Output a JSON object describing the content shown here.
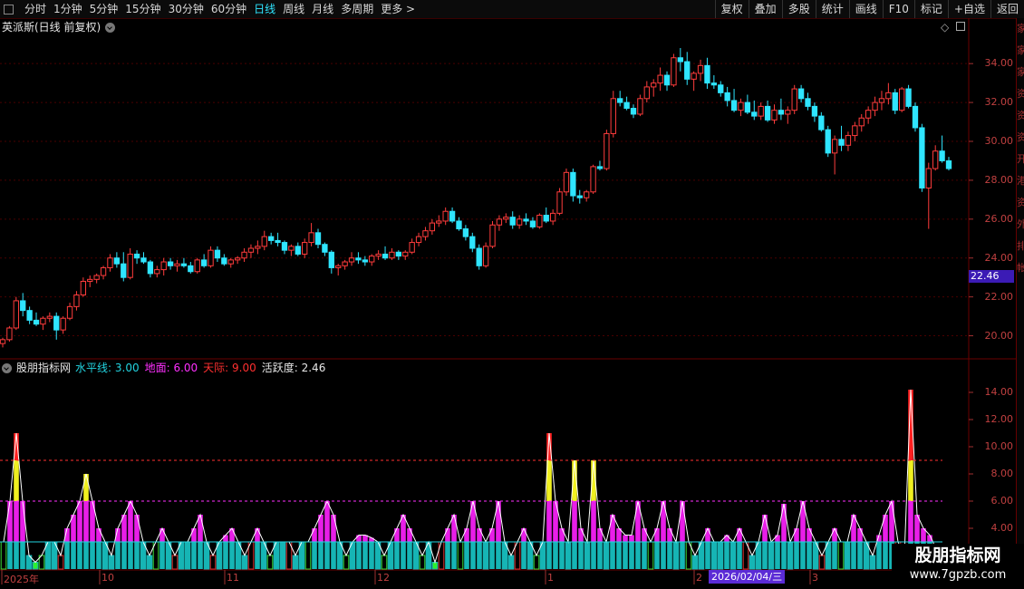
{
  "toolbar": {
    "periods": [
      "分时",
      "1分钟",
      "5分钟",
      "15分钟",
      "30分钟",
      "60分钟",
      "日线",
      "周线",
      "月线",
      "多周期",
      "更多 >"
    ],
    "active_period": "日线",
    "right_buttons": [
      "复权",
      "叠加",
      "多股",
      "统计",
      "画线",
      "F10",
      "标记",
      "+自选",
      "返回"
    ]
  },
  "main_panel": {
    "title": "英派斯(日线 前复权)",
    "y_ticks": [
      "34.00",
      "32.00",
      "30.00",
      "28.00",
      "26.00",
      "24.00",
      "22.00",
      "20.00"
    ],
    "current_price_tag": "22.46"
  },
  "indicator_panel": {
    "name": "股朋指标网",
    "legend": [
      {
        "label": "水平线: 3.00",
        "color": "#22d3e0"
      },
      {
        "label": "地面: 6.00",
        "color": "#ff30ff"
      },
      {
        "label": "天际: 9.00",
        "color": "#ff3030"
      },
      {
        "label": "活跃度: 2.46",
        "color": "#e6e6e6"
      }
    ],
    "y_ticks": [
      "14.00",
      "12.00",
      "10.00",
      "8.00",
      "6.00",
      "4.00",
      "2.00"
    ]
  },
  "x_axis": {
    "months": [
      "2025年",
      "10",
      "11",
      "12",
      "1",
      "2",
      "3"
    ],
    "cursor_date": "2026/02/04/三"
  },
  "watermark": {
    "title": "股朋指标网",
    "url": "www.7gpzb.com"
  },
  "side_strip_text": [
    "家",
    "家",
    "家",
    "资",
    "资",
    "资",
    "开",
    "港",
    "资",
    "外",
    "排",
    "帐"
  ],
  "colors": {
    "up": "#ff3c3c",
    "down": "#2fe5ff",
    "bg": "#000000",
    "grid": "#5a0000"
  },
  "chart_data": {
    "type": "candlestick+histogram",
    "price_axis_ylim": [
      19,
      35.5
    ],
    "candles_ohlc": [
      [
        19.6,
        19.9,
        19.4,
        19.8
      ],
      [
        19.8,
        20.5,
        19.7,
        20.4
      ],
      [
        20.4,
        22,
        20.3,
        21.8
      ],
      [
        21.8,
        22.2,
        21,
        21.3
      ],
      [
        21.3,
        21.5,
        20.6,
        20.8
      ],
      [
        20.8,
        21.2,
        20.5,
        20.6
      ],
      [
        20.6,
        21,
        20.3,
        20.9
      ],
      [
        20.9,
        21.2,
        20.7,
        21
      ],
      [
        21,
        21.2,
        19.8,
        20.3
      ],
      [
        20.3,
        21,
        20.1,
        20.9
      ],
      [
        20.9,
        21.7,
        20.8,
        21.5
      ],
      [
        21.5,
        22.3,
        21.3,
        22.1
      ],
      [
        22.1,
        23,
        22,
        22.8
      ],
      [
        22.8,
        23.1,
        22.5,
        22.9
      ],
      [
        22.9,
        23.2,
        22.7,
        23.1
      ],
      [
        23.1,
        23.6,
        22.9,
        23.5
      ],
      [
        23.5,
        24.2,
        23.3,
        24
      ],
      [
        24,
        24.3,
        23.5,
        23.7
      ],
      [
        23.7,
        24.3,
        22.8,
        23
      ],
      [
        23,
        24.5,
        22.9,
        24.2
      ],
      [
        24.2,
        24.4,
        23.7,
        24
      ],
      [
        24,
        24.3,
        23.7,
        23.8
      ],
      [
        23.8,
        23.9,
        23,
        23.2
      ],
      [
        23.2,
        23.6,
        23,
        23.4
      ],
      [
        23.4,
        24,
        23.1,
        23.8
      ],
      [
        23.8,
        24,
        23.4,
        23.6
      ],
      [
        23.6,
        23.9,
        23.3,
        23.7
      ],
      [
        23.7,
        24,
        23.5,
        23.6
      ],
      [
        23.6,
        23.8,
        23.2,
        23.3
      ],
      [
        23.3,
        24,
        23.2,
        23.9
      ],
      [
        23.9,
        24.2,
        23.5,
        23.6
      ],
      [
        23.6,
        24.6,
        23.5,
        24.4
      ],
      [
        24.4,
        24.6,
        23.8,
        24
      ],
      [
        24,
        24.2,
        23.6,
        23.7
      ],
      [
        23.7,
        24,
        23.5,
        23.9
      ],
      [
        23.9,
        24.1,
        23.7,
        24
      ],
      [
        24,
        24.5,
        23.8,
        24.3
      ],
      [
        24.3,
        24.7,
        24,
        24.5
      ],
      [
        24.5,
        24.9,
        24.2,
        24.6
      ],
      [
        24.6,
        25.4,
        24.4,
        25.1
      ],
      [
        25.1,
        25.3,
        24.7,
        24.9
      ],
      [
        24.9,
        25.3,
        24.6,
        24.8
      ],
      [
        24.8,
        24.9,
        24.2,
        24.4
      ],
      [
        24.4,
        24.7,
        24.1,
        24.6
      ],
      [
        24.6,
        24.8,
        24.1,
        24.2
      ],
      [
        24.2,
        25,
        24,
        24.8
      ],
      [
        24.8,
        25.8,
        24.6,
        25.3
      ],
      [
        25.3,
        25.5,
        24.5,
        24.7
      ],
      [
        24.7,
        24.8,
        24.1,
        24.3
      ],
      [
        24.3,
        24.4,
        23.2,
        23.5
      ],
      [
        23.5,
        23.7,
        23.1,
        23.6
      ],
      [
        23.6,
        23.9,
        23.4,
        23.8
      ],
      [
        23.8,
        24.3,
        23.6,
        24
      ],
      [
        24,
        24.3,
        23.7,
        23.9
      ],
      [
        23.9,
        24.1,
        23.6,
        23.8
      ],
      [
        23.8,
        24.2,
        23.6,
        24.1
      ],
      [
        24.1,
        24.4,
        23.9,
        24.2
      ],
      [
        24.2,
        24.6,
        23.9,
        24
      ],
      [
        24,
        24.5,
        23.9,
        24.3
      ],
      [
        24.3,
        24.4,
        23.9,
        24.1
      ],
      [
        24.1,
        24.4,
        23.9,
        24.3
      ],
      [
        24.3,
        25,
        24.2,
        24.8
      ],
      [
        24.8,
        25.3,
        24.6,
        25.1
      ],
      [
        25.1,
        25.6,
        24.9,
        25.4
      ],
      [
        25.4,
        26,
        25.2,
        25.8
      ],
      [
        25.8,
        26.2,
        25.6,
        25.9
      ],
      [
        25.9,
        26.6,
        25.7,
        26.4
      ],
      [
        26.4,
        26.6,
        25.8,
        25.9
      ],
      [
        25.9,
        26.1,
        25.4,
        25.5
      ],
      [
        25.5,
        25.7,
        24.9,
        25.1
      ],
      [
        25.1,
        25.3,
        24.3,
        24.5
      ],
      [
        24.5,
        24.7,
        23.4,
        23.6
      ],
      [
        23.6,
        24.8,
        23.5,
        24.6
      ],
      [
        24.6,
        25.9,
        24.5,
        25.7
      ],
      [
        25.7,
        26.2,
        25.4,
        26
      ],
      [
        26,
        26.3,
        25.8,
        26.1
      ],
      [
        26.1,
        26.4,
        25.5,
        25.7
      ],
      [
        25.7,
        26.2,
        25.5,
        26
      ],
      [
        26,
        26.3,
        25.7,
        25.9
      ],
      [
        25.9,
        26.1,
        25.5,
        25.6
      ],
      [
        25.6,
        26.3,
        25.5,
        26.2
      ],
      [
        26.2,
        26.6,
        25.8,
        25.9
      ],
      [
        25.9,
        26.5,
        25.7,
        26.3
      ],
      [
        26.3,
        27.6,
        26.2,
        27.4
      ],
      [
        27.4,
        28.6,
        27.2,
        28.4
      ],
      [
        28.4,
        28.6,
        26.9,
        27.2
      ],
      [
        27.2,
        27.5,
        26.8,
        27.1
      ],
      [
        27.1,
        27.5,
        26.9,
        27.4
      ],
      [
        27.4,
        28.8,
        27.3,
        28.7
      ],
      [
        28.7,
        29,
        28.5,
        28.6
      ],
      [
        28.6,
        30.6,
        28.5,
        30.4
      ],
      [
        30.4,
        32.6,
        30.2,
        32.2
      ],
      [
        32.2,
        32.6,
        31.8,
        32
      ],
      [
        32,
        32.3,
        31.6,
        31.7
      ],
      [
        31.7,
        31.9,
        31.2,
        31.4
      ],
      [
        31.4,
        32.4,
        31.3,
        32.2
      ],
      [
        32.2,
        33.1,
        32,
        32.8
      ],
      [
        32.8,
        33.2,
        32.3,
        33
      ],
      [
        33,
        33.8,
        32.6,
        33.4
      ],
      [
        33.4,
        33.6,
        32.6,
        32.9
      ],
      [
        32.9,
        34.5,
        32.8,
        34.3
      ],
      [
        34.3,
        34.8,
        33.6,
        34.1
      ],
      [
        34.1,
        34.6,
        32.9,
        33.2
      ],
      [
        33.2,
        33.6,
        32.6,
        33.5
      ],
      [
        33.5,
        34.2,
        33.1,
        33.9
      ],
      [
        33.9,
        34.3,
        32.7,
        33
      ],
      [
        33,
        33.4,
        32.7,
        32.9
      ],
      [
        32.9,
        33.1,
        32.3,
        32.5
      ],
      [
        32.5,
        32.8,
        31.8,
        32.1
      ],
      [
        32.1,
        32.7,
        31.5,
        31.6
      ],
      [
        31.6,
        32.2,
        31.3,
        32
      ],
      [
        32,
        32.4,
        31.4,
        31.5
      ],
      [
        31.5,
        32.1,
        31.1,
        31.3
      ],
      [
        31.3,
        32,
        31.1,
        31.8
      ],
      [
        31.8,
        32.1,
        31,
        31.1
      ],
      [
        31.1,
        31.9,
        30.9,
        31.6
      ],
      [
        31.6,
        32.2,
        31.1,
        31.4
      ],
      [
        31.4,
        31.8,
        30.9,
        31.6
      ],
      [
        31.6,
        32.9,
        31.4,
        32.7
      ],
      [
        32.7,
        32.9,
        32,
        32.2
      ],
      [
        32.2,
        32.5,
        31.6,
        31.8
      ],
      [
        31.8,
        32,
        31,
        31.3
      ],
      [
        31.3,
        31.5,
        30.5,
        30.6
      ],
      [
        30.6,
        30.8,
        29.2,
        29.4
      ],
      [
        29.4,
        30.3,
        28.3,
        30.1
      ],
      [
        30.1,
        30.8,
        29.5,
        29.8
      ],
      [
        29.8,
        30.5,
        29.5,
        30.3
      ],
      [
        30.3,
        31,
        30,
        30.8
      ],
      [
        30.8,
        31.4,
        30.5,
        31.2
      ],
      [
        31.2,
        31.8,
        30.9,
        31.6
      ],
      [
        31.6,
        32.3,
        31.3,
        32
      ],
      [
        32,
        32.6,
        31.6,
        32.2
      ],
      [
        32.2,
        33,
        31.9,
        32.5
      ],
      [
        32.5,
        32.7,
        31.4,
        31.6
      ],
      [
        31.6,
        32.8,
        31.5,
        32.7
      ],
      [
        32.7,
        32.9,
        31.7,
        31.8
      ],
      [
        31.8,
        32,
        30.5,
        30.7
      ],
      [
        30.7,
        30.9,
        27.4,
        27.6
      ],
      [
        27.6,
        28.9,
        25.5,
        28.6
      ],
      [
        28.6,
        29.8,
        28.5,
        29.5
      ],
      [
        29.5,
        30.3,
        28.9,
        29
      ],
      [
        29,
        29.2,
        28.5,
        28.6
      ]
    ],
    "indicator_ylim": [
      1,
      15.2
    ],
    "indicator_values": [
      3,
      6,
      11,
      6,
      2,
      1.5,
      2,
      3,
      3,
      2,
      4,
      5,
      6,
      8,
      6,
      4,
      3,
      2,
      4,
      5,
      6,
      5,
      3,
      2,
      3,
      4,
      3,
      2,
      3,
      3,
      4,
      5,
      3,
      2,
      3,
      3.5,
      4,
      3,
      2,
      3,
      4,
      3,
      2,
      3,
      3,
      3,
      2,
      3,
      3,
      4,
      5,
      6,
      5,
      3,
      2,
      3,
      3.5,
      3.5,
      3.3,
      3,
      2,
      3,
      4,
      5,
      4,
      3,
      2,
      3,
      1.5,
      3,
      4,
      5,
      3,
      4,
      6,
      4,
      3,
      4,
      6,
      3,
      2,
      3,
      4,
      3,
      2,
      3,
      11,
      6,
      4,
      3,
      9,
      4,
      3,
      9,
      4,
      3,
      5,
      4,
      3.5,
      3.5,
      6,
      4,
      3,
      4,
      6,
      4,
      3,
      6,
      3,
      2,
      3,
      4,
      3,
      3,
      3.5,
      3,
      4,
      3,
      2,
      3,
      5,
      3,
      3.5,
      5.8,
      3,
      4,
      6,
      4,
      3,
      2,
      3,
      4,
      3,
      3,
      5,
      4,
      3,
      2,
      3.5,
      5,
      6,
      3,
      2,
      14.2,
      5,
      4,
      3.5,
      2.5,
      2
    ]
  }
}
